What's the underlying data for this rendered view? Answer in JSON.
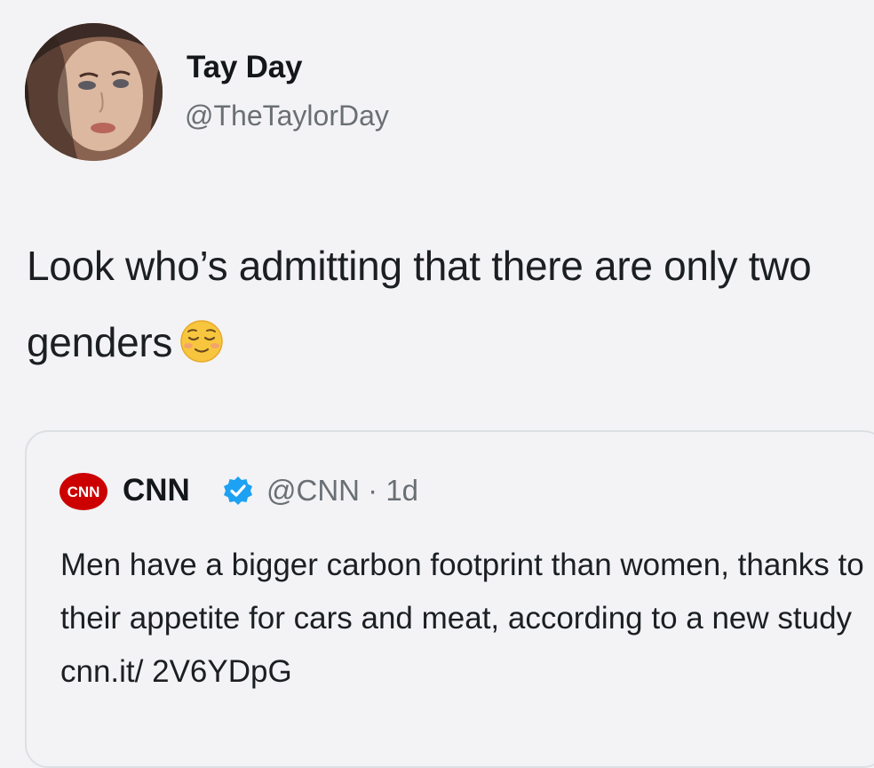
{
  "tweet": {
    "author_name": "Tay Day",
    "author_handle": "@TheTaylorDay",
    "text": "Look who’s admitting that there are only two genders",
    "emoji": "relieved-face-emoji",
    "quoted": {
      "logo": "CNN",
      "name": "CNN",
      "verified_icon": "verified-badge-icon",
      "handle_time": "@CNN · 1d",
      "text": "Men have a bigger carbon footprint than women, thanks to their appetite for cars and meat, according to a new study cnn.it/ 2V6YDpG"
    }
  },
  "colors": {
    "background": "#f3f3f5",
    "text": "#1c1f22",
    "secondary_text": "#6a6f74",
    "verified_blue": "#1da1f2",
    "cnn_red": "#cc0000",
    "quote_border": "#dcdfe2"
  }
}
